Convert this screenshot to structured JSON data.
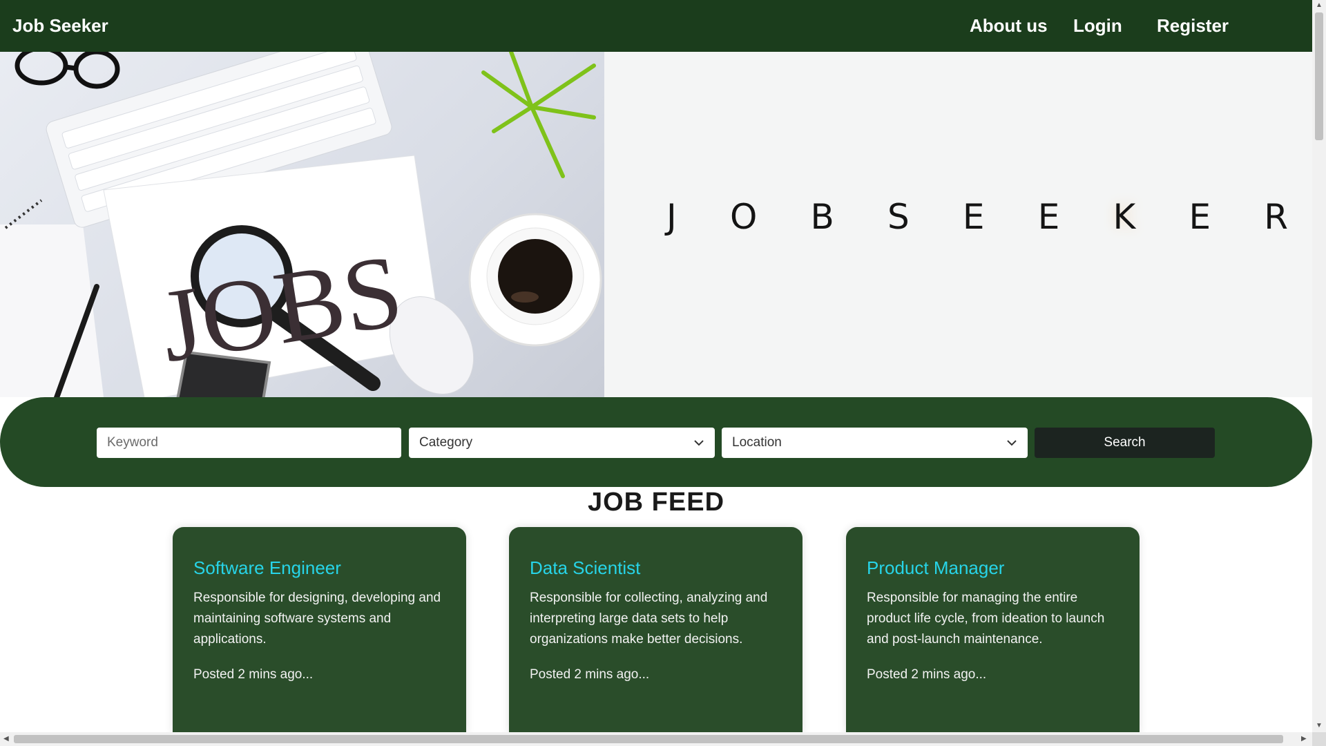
{
  "navbar": {
    "brand": "Job Seeker",
    "links": [
      "About us",
      "Login",
      "Register"
    ]
  },
  "hero": {
    "image_text": "JOBS",
    "title_letters": [
      "J",
      "O",
      "B",
      "S",
      "E",
      "E",
      "K",
      "E",
      "R"
    ]
  },
  "search": {
    "keyword_placeholder": "Keyword",
    "category_label": "Category",
    "location_label": "Location",
    "search_label": "Search"
  },
  "feed": {
    "title": "JOB FEED",
    "cards": [
      {
        "title": "Software Engineer",
        "description": "Responsible for designing, developing and maintaining software systems and applications.",
        "posted": "Posted 2 mins ago..."
      },
      {
        "title": "Data Scientist",
        "description": "Responsible for collecting, analyzing and interpreting large data sets to help organizations make better decisions.",
        "posted": "Posted 2 mins ago..."
      },
      {
        "title": "Product Manager",
        "description": "Responsible for managing the entire product life cycle, from ideation to launch and post-launch maintenance.",
        "posted": "Posted 2 mins ago..."
      }
    ]
  },
  "colors": {
    "navbar": "#1b3d1c",
    "search_bar": "#244a25",
    "card": "#2a4d2a",
    "card_title": "#27d4e8",
    "search_button": "#1c2420"
  }
}
